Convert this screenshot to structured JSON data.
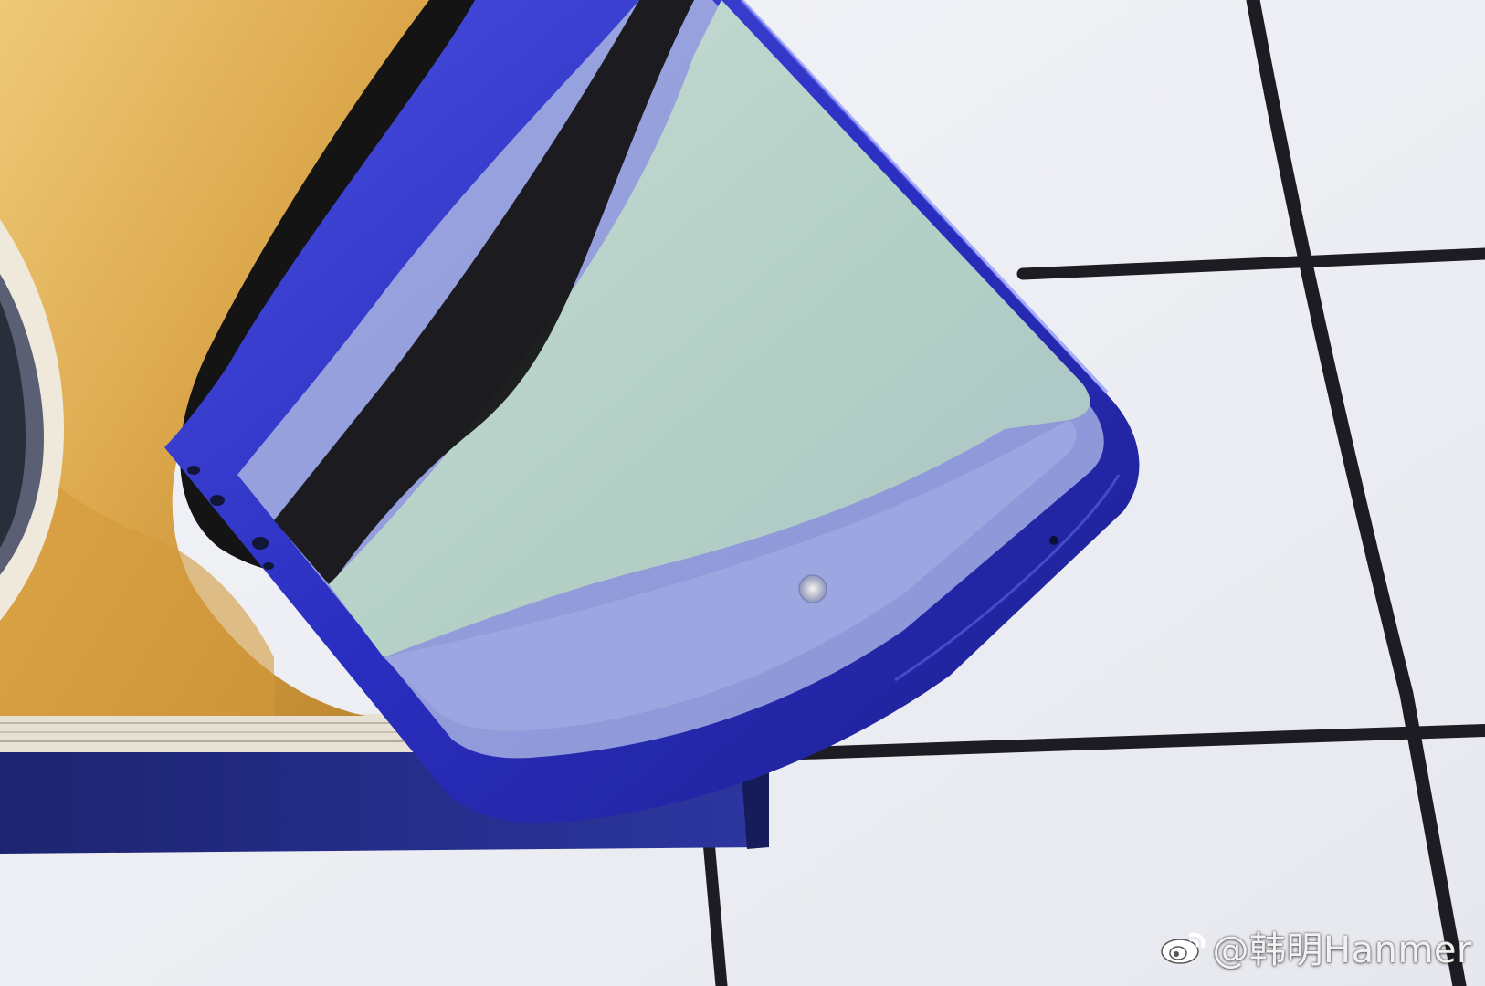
{
  "photo": {
    "subject": "phone",
    "colors": {
      "cloth_white": "#f1f2f6",
      "grid_line": "#1c1c22",
      "phone_blue": "#2f33c8",
      "screen": "#b7d2c8",
      "notebook_yellow": "#d9a544",
      "notebook_shadow": "#141414",
      "book_cover": "#27308a"
    }
  },
  "watermark": {
    "icon": "weibo-icon",
    "text": "@韩明Hanmer"
  }
}
